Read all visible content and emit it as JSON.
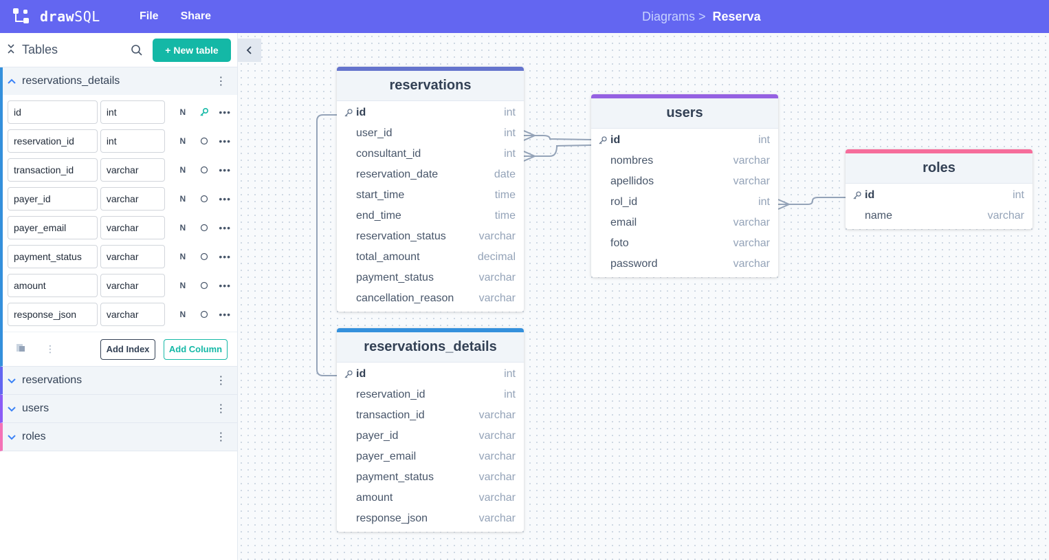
{
  "app": {
    "name_bold": "draw",
    "name_light": "SQL"
  },
  "menu": {
    "file": "File",
    "share": "Share"
  },
  "breadcrumb": {
    "parent": "Diagrams >",
    "current": "Reserva"
  },
  "sidebar": {
    "title": "Tables",
    "new_table": "+ New table",
    "expanded_table": {
      "name": "reservations_details",
      "columns": [
        {
          "name": "id",
          "type": "int",
          "nullable": "N"
        },
        {
          "name": "reservation_id",
          "type": "int",
          "nullable": "N"
        },
        {
          "name": "transaction_id",
          "type": "varchar",
          "nullable": "N"
        },
        {
          "name": "payer_id",
          "type": "varchar",
          "nullable": "N"
        },
        {
          "name": "payer_email",
          "type": "varchar",
          "nullable": "N"
        },
        {
          "name": "payment_status",
          "type": "varchar",
          "nullable": "N"
        },
        {
          "name": "amount",
          "type": "varchar",
          "nullable": "N"
        },
        {
          "name": "response_json",
          "type": "varchar",
          "nullable": "N"
        }
      ],
      "add_index": "Add Index",
      "add_column": "Add Column"
    },
    "collapsed_tables": [
      {
        "name": "reservations",
        "color": "#6366f1"
      },
      {
        "name": "users",
        "color": "#8b5cf6"
      },
      {
        "name": "roles",
        "color": "#f472b6"
      }
    ]
  },
  "diagram": {
    "tables": [
      {
        "name": "reservations",
        "color": "#6574cd",
        "fields": [
          {
            "name": "id",
            "type": "int",
            "pk": true
          },
          {
            "name": "user_id",
            "type": "int"
          },
          {
            "name": "consultant_id",
            "type": "int"
          },
          {
            "name": "reservation_date",
            "type": "date"
          },
          {
            "name": "start_time",
            "type": "time"
          },
          {
            "name": "end_time",
            "type": "time"
          },
          {
            "name": "reservation_status",
            "type": "varchar"
          },
          {
            "name": "total_amount",
            "type": "decimal"
          },
          {
            "name": "payment_status",
            "type": "varchar"
          },
          {
            "name": "cancellation_reason",
            "type": "varchar"
          }
        ]
      },
      {
        "name": "users",
        "color": "#9561e2",
        "fields": [
          {
            "name": "id",
            "type": "int",
            "pk": true
          },
          {
            "name": "nombres",
            "type": "varchar"
          },
          {
            "name": "apellidos",
            "type": "varchar"
          },
          {
            "name": "rol_id",
            "type": "int"
          },
          {
            "name": "email",
            "type": "varchar"
          },
          {
            "name": "foto",
            "type": "varchar"
          },
          {
            "name": "password",
            "type": "varchar"
          }
        ]
      },
      {
        "name": "roles",
        "color": "#f66d9b",
        "fields": [
          {
            "name": "id",
            "type": "int",
            "pk": true
          },
          {
            "name": "name",
            "type": "varchar"
          }
        ]
      },
      {
        "name": "reservations_details",
        "color": "#3490dc",
        "fields": [
          {
            "name": "id",
            "type": "int",
            "pk": true
          },
          {
            "name": "reservation_id",
            "type": "int"
          },
          {
            "name": "transaction_id",
            "type": "varchar"
          },
          {
            "name": "payer_id",
            "type": "varchar"
          },
          {
            "name": "payer_email",
            "type": "varchar"
          },
          {
            "name": "payment_status",
            "type": "varchar"
          },
          {
            "name": "amount",
            "type": "varchar"
          },
          {
            "name": "response_json",
            "type": "varchar"
          }
        ]
      }
    ]
  },
  "colors": {
    "topbar": "#6366f1",
    "accent": "#14b8a6"
  }
}
